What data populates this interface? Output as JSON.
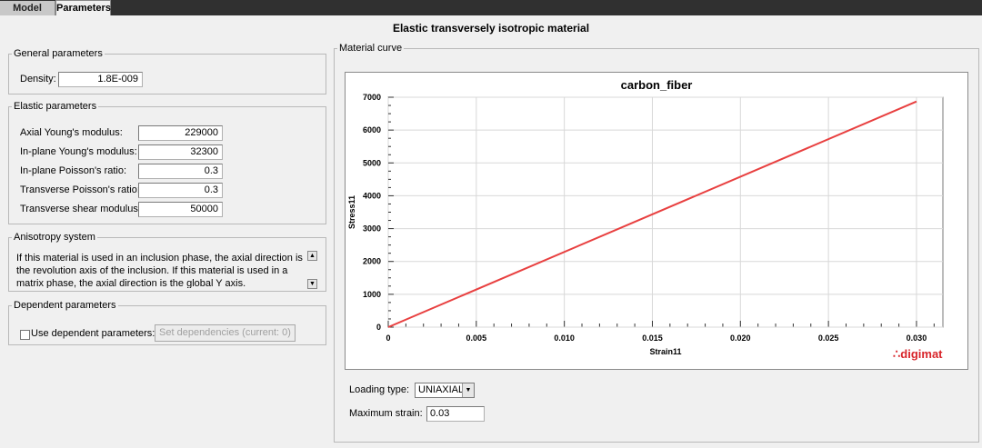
{
  "tabs": [
    {
      "label": "Model",
      "active": false
    },
    {
      "label": "Parameters",
      "active": true
    }
  ],
  "page_title": "Elastic transversely isotropic material",
  "general": {
    "title": "General parameters",
    "density_label": "Density:",
    "density_value": "1.8E-009"
  },
  "elastic": {
    "title": "Elastic parameters",
    "fields": [
      {
        "label": "Axial Young's modulus:",
        "value": "229000"
      },
      {
        "label": "In-plane Young's modulus:",
        "value": "32300"
      },
      {
        "label": "In-plane Poisson's ratio:",
        "value": "0.3"
      },
      {
        "label": "Transverse Poisson's ratio:",
        "value": "0.3"
      },
      {
        "label": "Transverse shear modulus:",
        "value": "50000"
      }
    ]
  },
  "anisotropy": {
    "title": "Anisotropy system",
    "text": "If this material is used in an inclusion phase, the axial direction is the revolution axis of the inclusion.  If this material is used in a matrix phase, the axial direction is the global Y axis."
  },
  "dependent": {
    "title": "Dependent parameters",
    "checkbox_label": "Use dependent parameters:",
    "checked": false,
    "button_label": "Set dependencies (current: 0)"
  },
  "material_curve": {
    "title": "Material curve",
    "loading_type_label": "Loading type:",
    "loading_type_value": "UNIAXIAL_",
    "max_strain_label": "Maximum strain:",
    "max_strain_value": "0.03",
    "logo_text": "digimat",
    "logo_color": "#d8242a"
  },
  "chart_data": {
    "type": "line",
    "title": "carbon_fiber",
    "xlabel": "Strain11",
    "ylabel": "Stress11",
    "xlim": [
      0,
      0.0315
    ],
    "ylim": [
      0,
      7000
    ],
    "xticks": [
      0,
      0.005,
      0.01,
      0.015,
      0.02,
      0.025,
      0.03
    ],
    "xtick_labels": [
      "0",
      "0.005",
      "0.010",
      "0.015",
      "0.020",
      "0.025",
      "0.030"
    ],
    "yticks": [
      0,
      1000,
      2000,
      3000,
      4000,
      5000,
      6000,
      7000
    ],
    "ytick_labels": [
      "0",
      "1000",
      "2000",
      "3000",
      "4000",
      "5000",
      "6000",
      "7000"
    ],
    "grid": true,
    "series": [
      {
        "color": "#e84040",
        "x": [
          0,
          0.03
        ],
        "y": [
          0,
          6870
        ]
      }
    ]
  }
}
